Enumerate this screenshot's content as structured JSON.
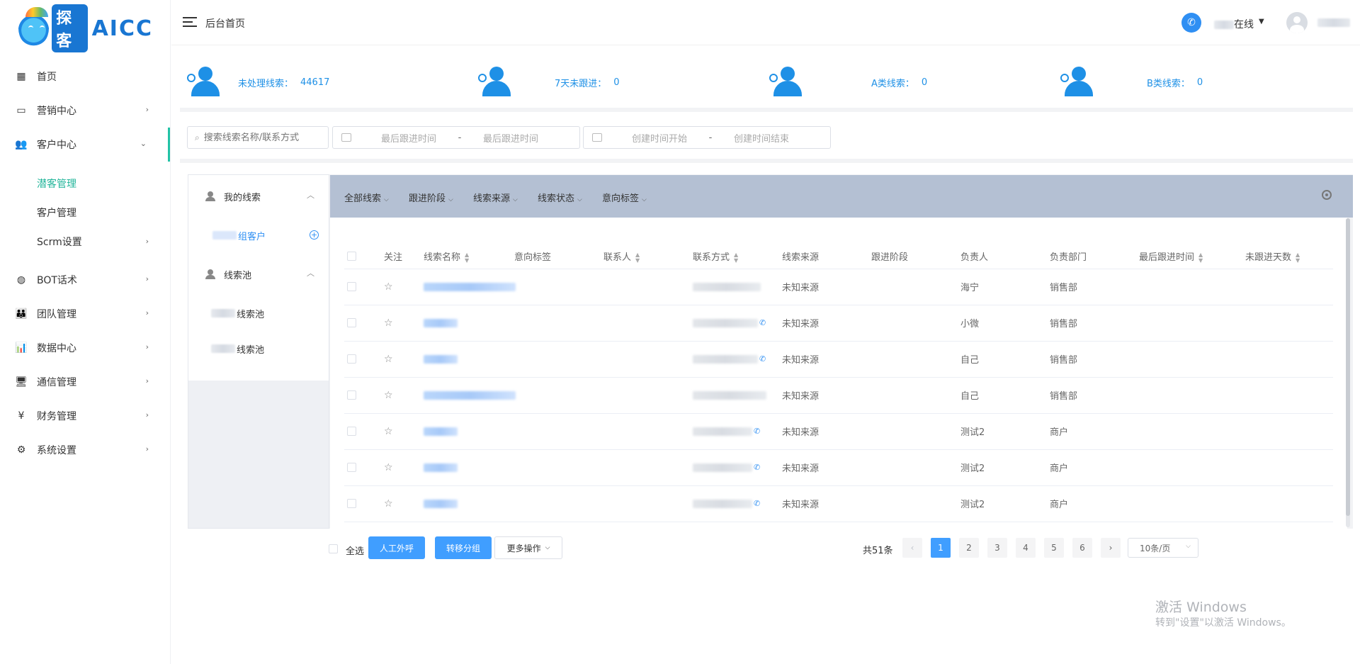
{
  "logo": {
    "box_text": "探客",
    "text": "AICC"
  },
  "header": {
    "crumb": "后台首页",
    "status_text": "在线"
  },
  "sidebar": {
    "items": [
      {
        "label": "首页",
        "icon": "dashboard-icon"
      },
      {
        "label": "营销中心",
        "icon": "monitor-icon"
      },
      {
        "label": "客户中心",
        "icon": "users-icon"
      },
      {
        "label": "BOT话术",
        "icon": "globe-icon"
      },
      {
        "label": "团队管理",
        "icon": "team-icon"
      },
      {
        "label": "数据中心",
        "icon": "bar-chart-icon"
      },
      {
        "label": "通信管理",
        "icon": "desktop-icon"
      },
      {
        "label": "财务管理",
        "icon": "yen-icon"
      },
      {
        "label": "系统设置",
        "icon": "gear-icon"
      }
    ],
    "subitems": [
      {
        "label": "潜客管理"
      },
      {
        "label": "客户管理"
      },
      {
        "label": "Scrm设置"
      }
    ]
  },
  "stats": [
    {
      "label": "未处理线索：",
      "value": "44617"
    },
    {
      "label": "7天未跟进：",
      "value": "0"
    },
    {
      "label": "A类线索：",
      "value": "0"
    },
    {
      "label": "B类线索：",
      "value": "0"
    }
  ],
  "filters": {
    "search_placeholder": "搜索线索名称/联系方式",
    "follow_start": "最后跟进时间",
    "follow_end": "最后跟进时间",
    "create_start": "创建时间开始",
    "create_end": "创建时间结束",
    "sep": "-"
  },
  "leftpanel": {
    "my_leads": "我的线索",
    "my_group": "组客户",
    "pool": "线索池",
    "pool_a": "线索池",
    "pool_b": "线索池"
  },
  "toolbar": {
    "items": [
      "全部线索",
      "跟进阶段",
      "线索来源",
      "线索状态",
      "意向标签"
    ]
  },
  "table": {
    "headers": [
      "关注",
      "线索名称",
      "意向标签",
      "联系人",
      "联系方式",
      "线索来源",
      "跟进阶段",
      "负责人",
      "负责部门",
      "最后跟进时间",
      "未跟进天数"
    ],
    "rows": [
      {
        "source": "未知来源",
        "owner": "海宁",
        "dept": "销售部"
      },
      {
        "source": "未知来源",
        "owner": "小微",
        "dept": "销售部"
      },
      {
        "source": "未知来源",
        "owner": "自己",
        "dept": "销售部"
      },
      {
        "source": "未知来源",
        "owner": "自己",
        "dept": "销售部"
      },
      {
        "source": "未知来源",
        "owner": "测试2",
        "dept": "商户"
      },
      {
        "source": "未知来源",
        "owner": "测试2",
        "dept": "商户"
      },
      {
        "source": "未知来源",
        "owner": "测试2",
        "dept": "商户"
      }
    ]
  },
  "footer": {
    "select_all": "全选",
    "manual_call": "人工外呼",
    "transfer_group": "转移分组",
    "more_actions": "更多操作",
    "total": "共51条",
    "pages": [
      "1",
      "2",
      "3",
      "4",
      "5",
      "6"
    ],
    "page_size": "10条/页"
  },
  "watermark": {
    "line1": "激活 Windows",
    "line2": "转到\"设置\"以激活 Windows。"
  },
  "colors": {
    "accent": "#409eff",
    "active_menu": "#22b59a",
    "toolbar_bg": "#b4c0d3"
  }
}
